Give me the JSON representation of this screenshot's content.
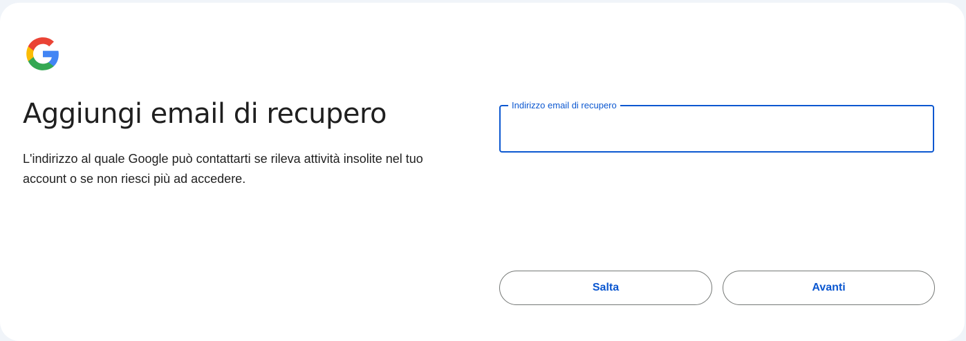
{
  "page": {
    "title": "Aggiungi email di recupero",
    "description": "L'indirizzo al quale Google può contattarti se rileva attività insolite nel tuo account o se non riesci più ad accedere."
  },
  "logo": {
    "icon": "google-g-icon",
    "colors": {
      "blue": "#4285F4",
      "red": "#EA4335",
      "yellow": "#FBBC05",
      "green": "#34A853"
    }
  },
  "form": {
    "email_label": "Indirizzo email di recupero",
    "email_value": ""
  },
  "actions": {
    "skip_label": "Salta",
    "next_label": "Avanti"
  },
  "colors": {
    "accent": "#0b57d0",
    "text": "#1f1f1f",
    "background": "#f0f4f9",
    "card": "#ffffff"
  }
}
